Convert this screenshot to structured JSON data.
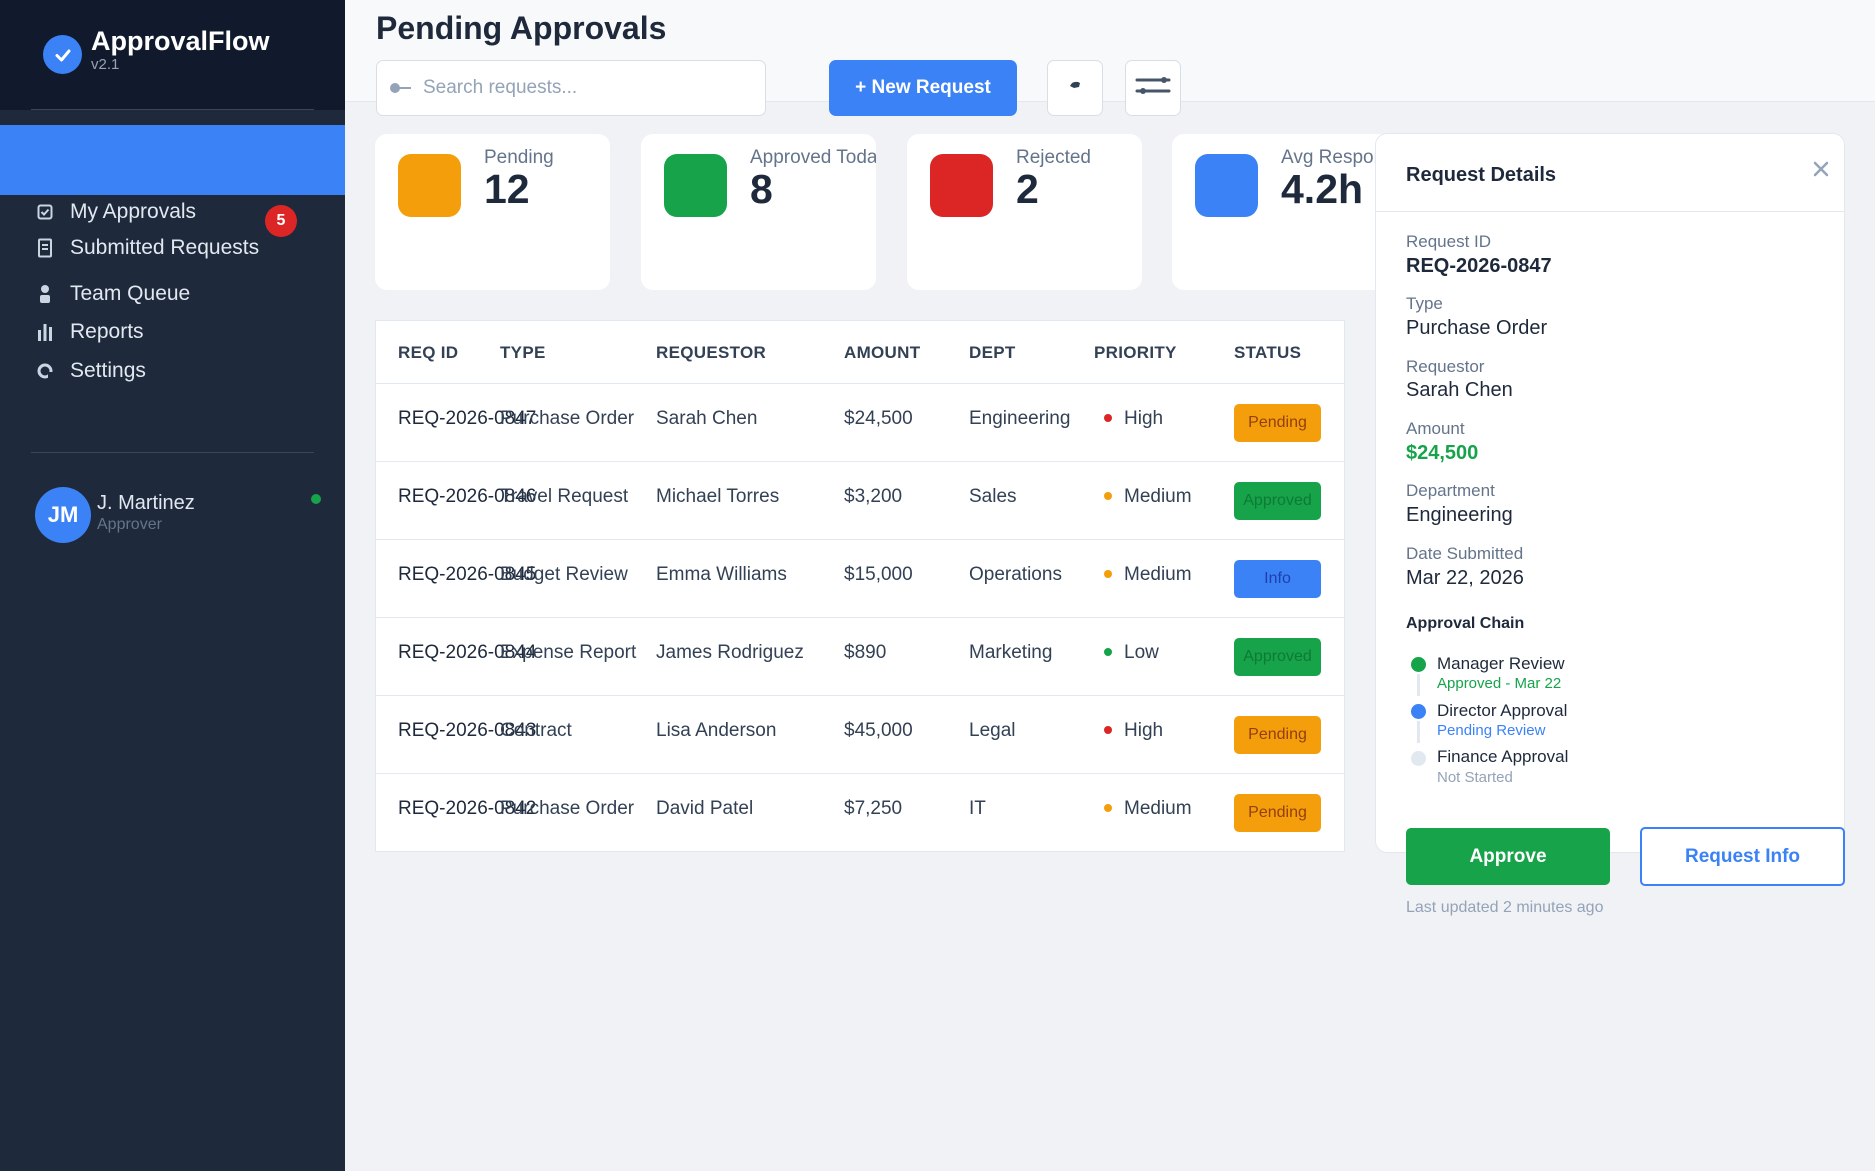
{
  "app": {
    "name": "ApprovalFlow",
    "version": "v2.1"
  },
  "nav": {
    "items": [
      {
        "label": "My Approvals",
        "badge": "5"
      },
      {
        "label": "Submitted Requests"
      },
      {
        "label": "Team Queue"
      },
      {
        "label": "Reports"
      },
      {
        "label": "Settings"
      }
    ]
  },
  "user": {
    "initials": "JM",
    "name": "J. Martinez",
    "role": "Approver"
  },
  "header": {
    "title": "Pending Approvals",
    "search_placeholder": "Search requests...",
    "new_request_label": "+ New Request"
  },
  "stats": [
    {
      "label": "Pending",
      "value": "12",
      "color": "#f59e0b"
    },
    {
      "label": "Approved Today",
      "value": "8",
      "color": "#16a34a"
    },
    {
      "label": "Rejected",
      "value": "2",
      "color": "#dc2626"
    },
    {
      "label": "Avg Response",
      "value": "4.2h",
      "color": "#3b82f6"
    }
  ],
  "table": {
    "columns": [
      "REQ ID",
      "TYPE",
      "REQUESTOR",
      "AMOUNT",
      "DEPT",
      "PRIORITY",
      "STATUS"
    ],
    "rows": [
      {
        "id": "REQ-2026-0847",
        "type": "Purchase Order",
        "requestor": "Sarah Chen",
        "amount": "$24,500",
        "dept": "Engineering",
        "priority": "High",
        "status": "Pending"
      },
      {
        "id": "REQ-2026-0846",
        "type": "Travel Request",
        "requestor": "Michael Torres",
        "amount": "$3,200",
        "dept": "Sales",
        "priority": "Medium",
        "status": "Approved"
      },
      {
        "id": "REQ-2026-0845",
        "type": "Budget Review",
        "requestor": "Emma Williams",
        "amount": "$15,000",
        "dept": "Operations",
        "priority": "Medium",
        "status": "Info"
      },
      {
        "id": "REQ-2026-0844",
        "type": "Expense Report",
        "requestor": "James Rodriguez",
        "amount": "$890",
        "dept": "Marketing",
        "priority": "Low",
        "status": "Approved"
      },
      {
        "id": "REQ-2026-0843",
        "type": "Contract",
        "requestor": "Lisa Anderson",
        "amount": "$45,000",
        "dept": "Legal",
        "priority": "High",
        "status": "Pending"
      },
      {
        "id": "REQ-2026-0842",
        "type": "Purchase Order",
        "requestor": "David Patel",
        "amount": "$7,250",
        "dept": "IT",
        "priority": "Medium",
        "status": "Pending"
      }
    ]
  },
  "priority_colors": {
    "High": "#dc2626",
    "Medium": "#f59e0b",
    "Low": "#16a34a"
  },
  "details": {
    "title": "Request Details",
    "fields": [
      {
        "label": "Request ID",
        "value": "REQ-2026-0847"
      },
      {
        "label": "Type",
        "value": "Purchase Order"
      },
      {
        "label": "Requestor",
        "value": "Sarah Chen"
      },
      {
        "label": "Amount",
        "value": "$24,500"
      },
      {
        "label": "Department",
        "value": "Engineering"
      },
      {
        "label": "Date Submitted",
        "value": "Mar 22, 2026"
      }
    ],
    "chain_title": "Approval Chain",
    "chain": [
      {
        "name": "Manager Review",
        "status": "Approved - Mar 22",
        "color": "#16a34a"
      },
      {
        "name": "Director Approval",
        "status": "Pending Review",
        "color": "#3b82f6"
      },
      {
        "name": "Finance Approval",
        "status": "Not Started",
        "color": "#e2e8f0"
      }
    ],
    "approve_label": "Approve",
    "request_info_label": "Request Info",
    "last_updated": "Last updated 2 minutes ago"
  }
}
